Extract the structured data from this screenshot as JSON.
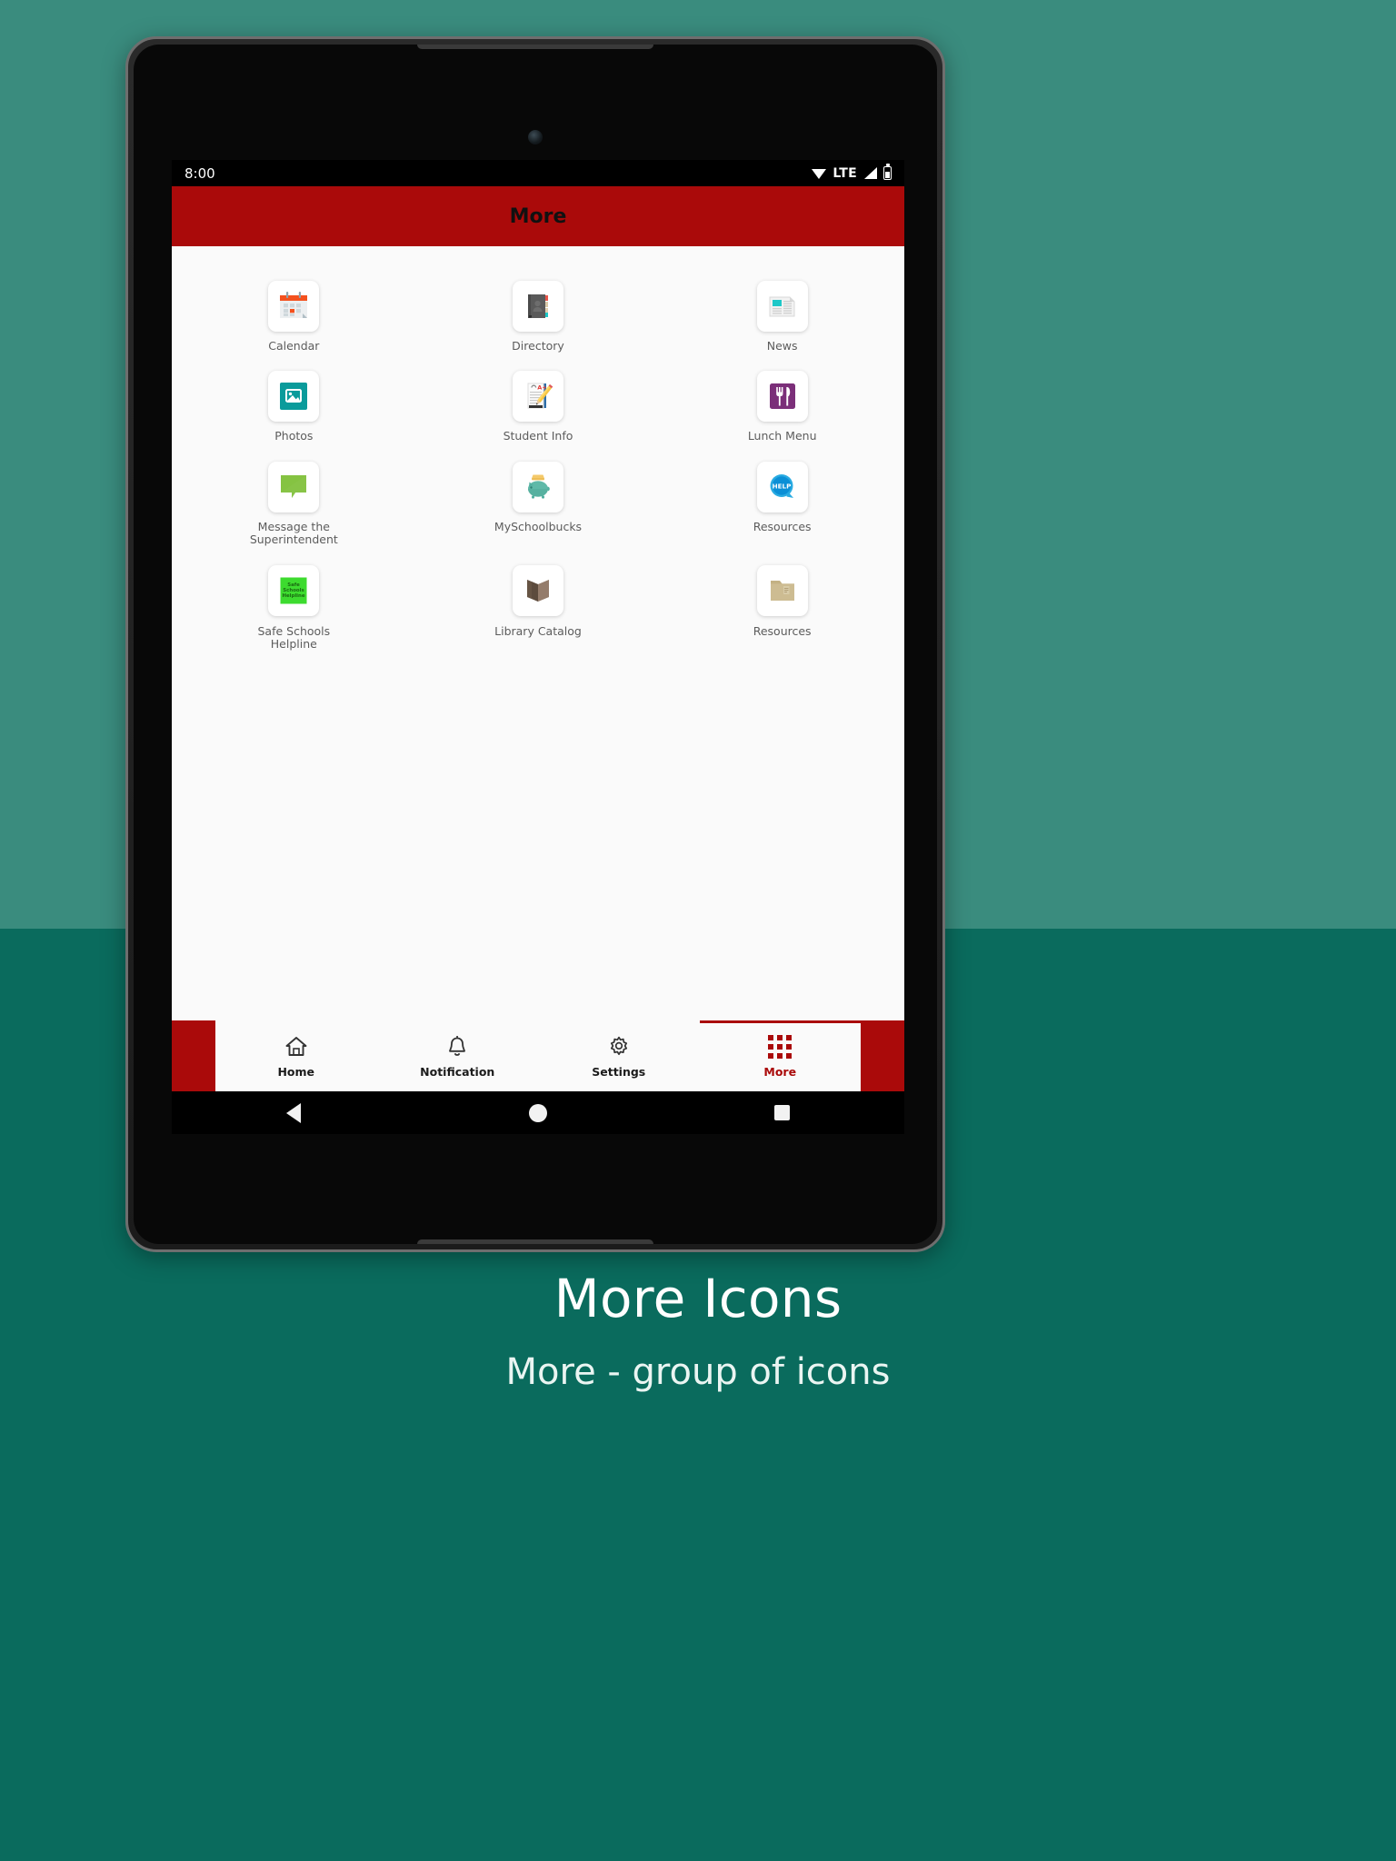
{
  "statusbar": {
    "time": "8:00",
    "network_label": "LTE",
    "icons": [
      "wifi-icon",
      "signal-icon",
      "battery-icon"
    ]
  },
  "appbar": {
    "title": "More"
  },
  "grid": {
    "items": [
      {
        "label": "Calendar",
        "icon": "calendar-icon"
      },
      {
        "label": "Directory",
        "icon": "address-book-icon"
      },
      {
        "label": "News",
        "icon": "newspaper-icon"
      },
      {
        "label": "Photos",
        "icon": "photo-icon"
      },
      {
        "label": "Student Info",
        "icon": "report-card-icon"
      },
      {
        "label": "Lunch Menu",
        "icon": "fork-knife-icon"
      },
      {
        "label": "Message the\nSuperintendent",
        "icon": "speech-bubble-icon"
      },
      {
        "label": "MySchoolbucks",
        "icon": "piggy-bank-icon"
      },
      {
        "label": "Resources",
        "icon": "help-bubble-icon"
      },
      {
        "label": "Safe Schools\nHelpline",
        "icon": "safe-schools-helpline-icon"
      },
      {
        "label": "Library Catalog",
        "icon": "open-book-icon"
      },
      {
        "label": "Resources",
        "icon": "folder-icon"
      }
    ],
    "helpline_badge_text": "Safe\nSchools\nHelpline",
    "help_badge_text": "HELP",
    "student_info_grade": "A+"
  },
  "bottom_nav": {
    "items": [
      {
        "label": "Home",
        "icon": "home-icon",
        "active": false
      },
      {
        "label": "Notification",
        "icon": "bell-icon",
        "active": false
      },
      {
        "label": "Settings",
        "icon": "gear-icon",
        "active": false
      },
      {
        "label": "More",
        "icon": "grid-dots-icon",
        "active": true
      }
    ]
  },
  "android_nav": {
    "back": "back-triangle-icon",
    "home": "home-circle-icon",
    "recents": "recents-square-icon"
  },
  "caption": {
    "title": "More Icons",
    "subtitle": "More - group of icons"
  },
  "colors": {
    "brand_red": "#aa0a0a",
    "background_top": "#3a8c7e",
    "background_bottom": "#0a6b5d",
    "screen_bg": "#fafafa",
    "teal_accent": "#19a0a0",
    "green_accent": "#7ac143",
    "purple_accent": "#7b2f79"
  }
}
